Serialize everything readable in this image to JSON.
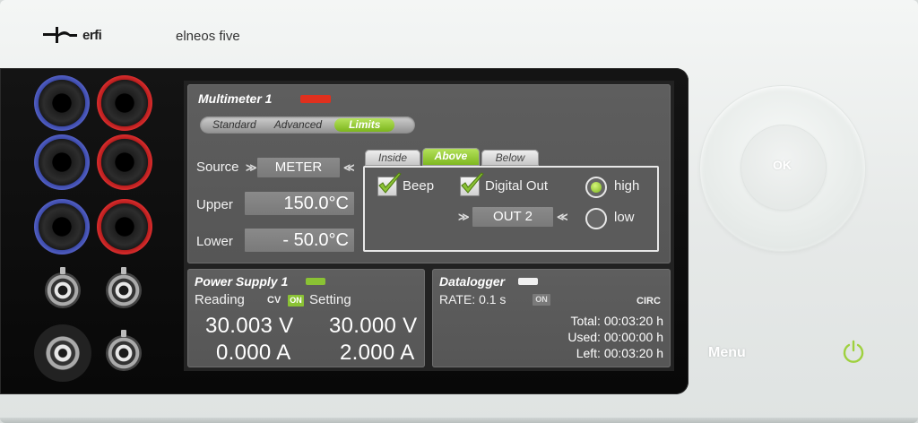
{
  "brand": {
    "logo_text": "erfi",
    "product": "elneos five"
  },
  "colors": {
    "accent_green": "#8ac234",
    "indicator_red": "#e0301e",
    "indicator_green": "#8ac234",
    "indicator_white": "#f0f0f0",
    "jack_blue": "#3c4aa8",
    "jack_red": "#d02020",
    "bnc_yellow": "#ecd400"
  },
  "multimeter": {
    "title": "Multimeter 1",
    "tabs": [
      {
        "label": "Standard",
        "active": false
      },
      {
        "label": "Advanced",
        "active": false
      },
      {
        "label": "Limits",
        "active": true
      }
    ],
    "source_label": "Source",
    "source_value": "METER",
    "upper_label": "Upper",
    "upper_value": "150.0°C",
    "lower_label": "Lower",
    "lower_value": "- 50.0°C",
    "limit_tabs": [
      {
        "label": "Inside",
        "active": false
      },
      {
        "label": "Above",
        "active": true
      },
      {
        "label": "Below",
        "active": false
      }
    ],
    "beep_label": "Beep",
    "beep_checked": true,
    "digital_out_label": "Digital Out",
    "digital_out_checked": true,
    "output_value": "OUT 2",
    "high_label": "high",
    "low_label": "low",
    "level_selected": "high"
  },
  "power_supply": {
    "title": "Power Supply 1",
    "reading_label": "Reading",
    "mode": "CV",
    "on_badge": "ON",
    "setting_label": "Setting",
    "reading_voltage": "30.003 V",
    "reading_current": "0.000 A",
    "setting_voltage": "30.000 V",
    "setting_current": "2.000 A"
  },
  "datalogger": {
    "title": "Datalogger",
    "rate_label": "RATE: 0.1 s",
    "on_badge": "ON",
    "mode": "CIRC",
    "total": "Total: 00:03:20 h",
    "used": "Used: 00:00:00 h",
    "left": "Left: 00:03:20 h"
  },
  "controls": {
    "ok_label": "OK",
    "menu_label": "Menu",
    "power_icon": "power-icon"
  }
}
